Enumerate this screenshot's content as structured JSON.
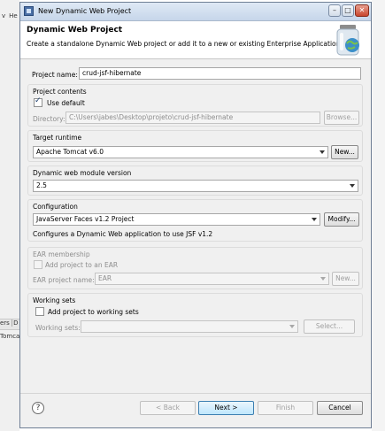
{
  "ide": {
    "menu_items": [
      "v",
      "He"
    ],
    "tab_fragment": "ers",
    "tab_fragment_2": "D",
    "tomcat_fragment": "Tomcat"
  },
  "window": {
    "title": "New Dynamic Web Project",
    "minimize_glyph": "–",
    "maximize_glyph": "□",
    "close_glyph": "✕"
  },
  "banner": {
    "title": "Dynamic Web Project",
    "description": "Create a standalone Dynamic Web project or add it to a new or existing Enterprise Application."
  },
  "project_name": {
    "label": "Project name:",
    "value": "crud-jsf-hibernate"
  },
  "project_contents": {
    "title": "Project contents",
    "use_default_label": "Use default",
    "use_default_checked": true,
    "directory_label": "Directory:",
    "directory_value": "C:\\Users\\jabes\\Desktop\\projeto\\crud-jsf-hibernate",
    "browse_label": "Browse..."
  },
  "target_runtime": {
    "title": "Target runtime",
    "selected": "Apache Tomcat v6.0",
    "new_label": "New..."
  },
  "web_module": {
    "title": "Dynamic web module version",
    "selected": "2.5"
  },
  "configuration": {
    "title": "Configuration",
    "selected": "JavaServer Faces v1.2 Project",
    "modify_label": "Modify...",
    "description": "Configures a Dynamic Web application to use JSF v1.2"
  },
  "ear": {
    "title": "EAR membership",
    "add_label": "Add project to an EAR",
    "add_checked": false,
    "project_name_label": "EAR project name:",
    "project_name_value": "EAR",
    "new_label": "New..."
  },
  "working_sets": {
    "title": "Working sets",
    "add_label": "Add project to working sets",
    "add_checked": false,
    "label": "Working sets:",
    "value": "",
    "select_label": "Select..."
  },
  "footer": {
    "help_glyph": "?",
    "back_label": "< Back",
    "next_label": "Next >",
    "finish_label": "Finish",
    "cancel_label": "Cancel"
  }
}
